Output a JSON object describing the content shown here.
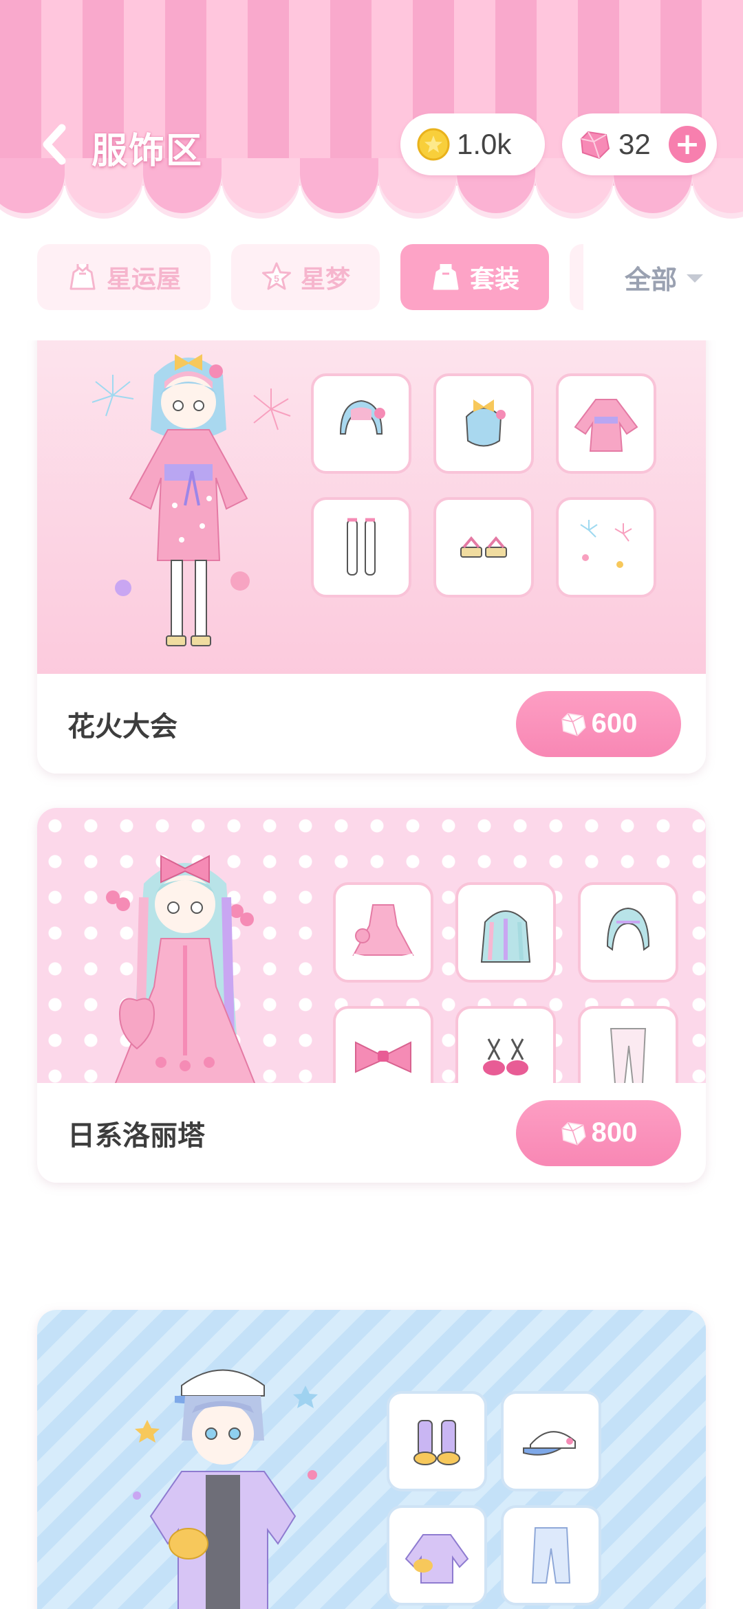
{
  "header": {
    "title": "服饰区",
    "coins": "1.0k",
    "gems": "32",
    "add_label": "+"
  },
  "tabs": [
    {
      "label": "星运屋",
      "icon": "dress-icon",
      "active": false
    },
    {
      "label": "星梦",
      "icon": "star-5-icon",
      "active": false
    },
    {
      "label": "套装",
      "icon": "dress-icon",
      "active": true
    }
  ],
  "filter": {
    "label": "全部"
  },
  "outfits": [
    {
      "name": "花火大会",
      "price": "600",
      "items": [
        "hair-front-icon",
        "hair-back-icon",
        "kimono-icon",
        "stockings-icon",
        "sandals-icon",
        "fireworks-background-icon"
      ]
    },
    {
      "name": "日系洛丽塔",
      "price": "800",
      "items": [
        "lolita-dress-icon",
        "long-wavy-hair-icon",
        "hair-bangs-icon",
        "pink-bow-icon",
        "pink-shoes-icon",
        "white-tights-icon"
      ]
    },
    {
      "name": "",
      "price": "",
      "items": [
        "sneakers-icon",
        "cap-icon",
        "jacket-icon",
        "pants-icon"
      ]
    }
  ],
  "colors": {
    "accent_pink": "#f887b4",
    "awning_pink": "#f9a9cc",
    "awning_light": "#ffc6dd",
    "tab_inactive_bg": "#fff0f5",
    "tab_active_bg": "#fda3c6",
    "filter_text": "#9aa1b1"
  }
}
